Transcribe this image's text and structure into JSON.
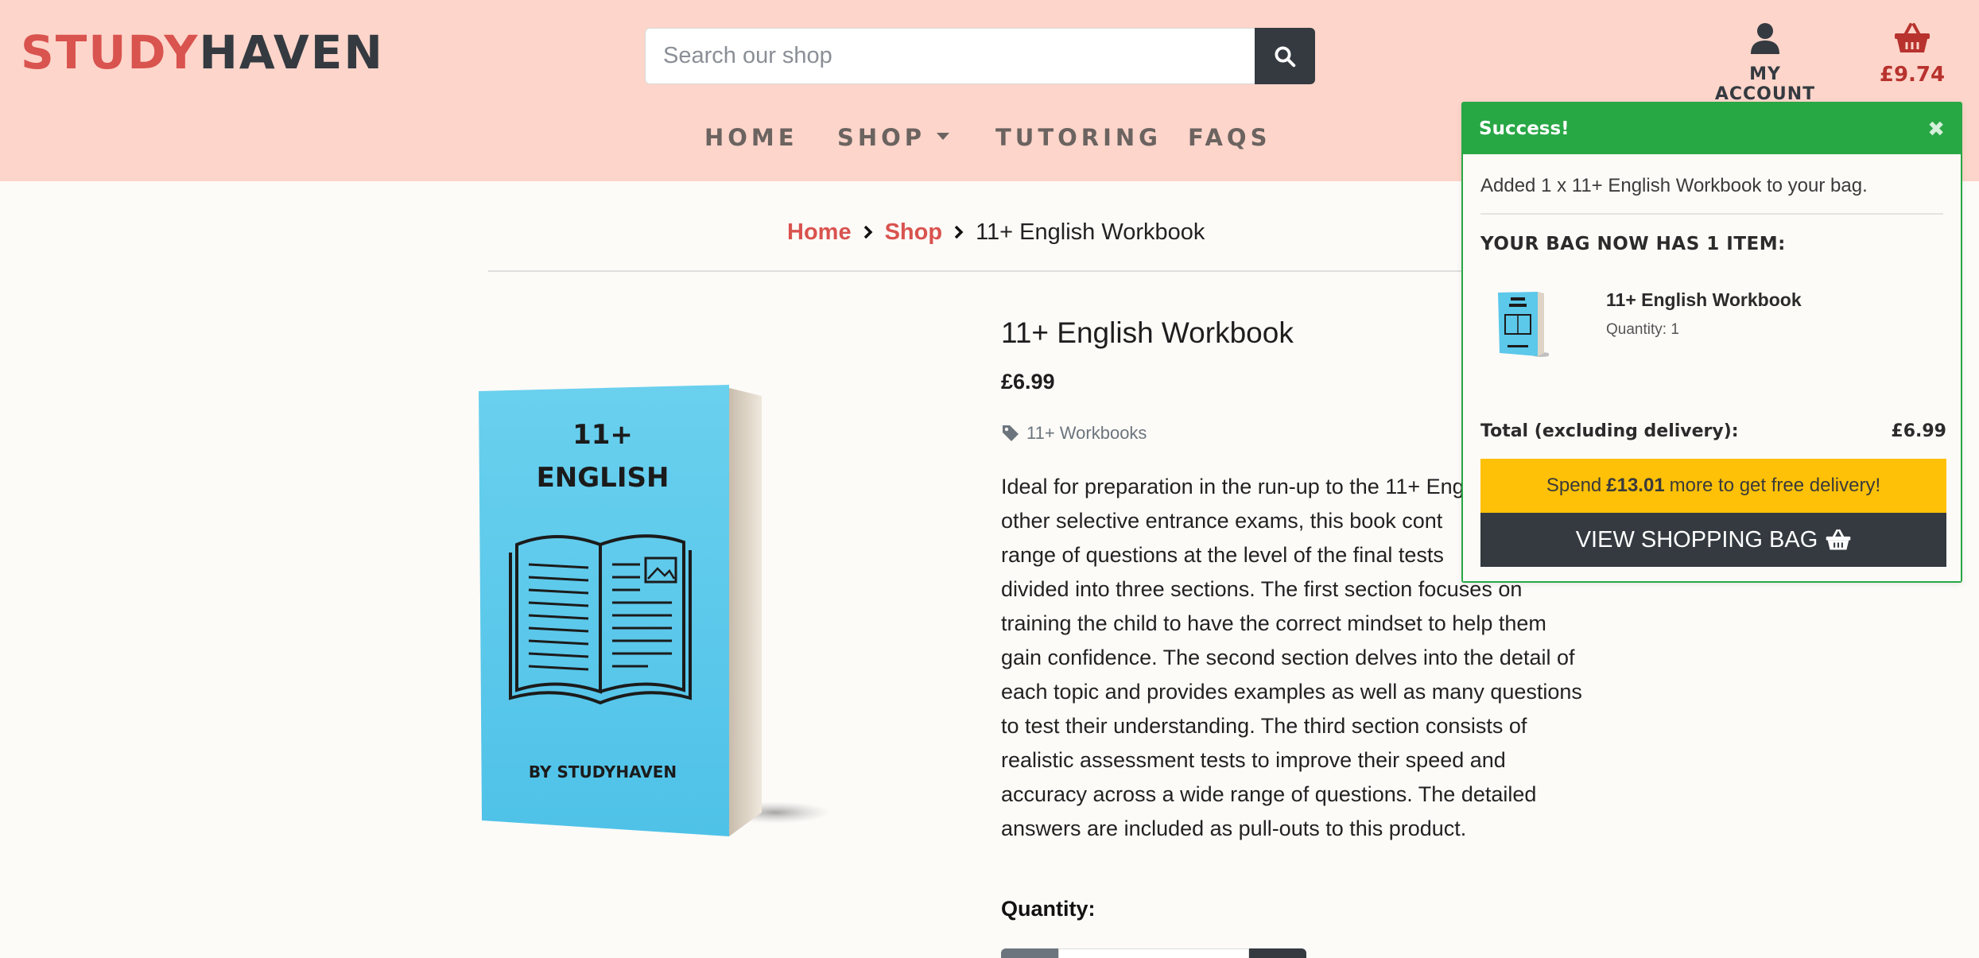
{
  "header": {
    "logo_part1": "STUDY",
    "logo_part2": "HAVEN",
    "search_placeholder": "Search our shop",
    "search_icon": "search-icon",
    "account_label": "MY ACCOUNT",
    "account_icon": "user-icon",
    "bag_icon": "basket-icon",
    "bag_total": "£9.74"
  },
  "nav": {
    "items": [
      {
        "label": "HOME"
      },
      {
        "label": "SHOP"
      },
      {
        "label": "TUTORING"
      },
      {
        "label": "FAQS"
      }
    ]
  },
  "breadcrumb": {
    "home": "Home",
    "shop": "Shop",
    "current": "11+ English Workbook"
  },
  "product": {
    "title": "11+ English Workbook",
    "price": "£6.99",
    "category": "11+ Workbooks",
    "cover_line1": "11+",
    "cover_line2": "ENGLISH",
    "cover_author": "BY STUDYHAVEN",
    "description_lines": [
      "Ideal for preparation in the run-up to the 11+ Eng",
      "other selective entrance exams, this book cont",
      "range of questions at the level of the final tests",
      "divided into three sections. The first section focuses on",
      "training the child to have the correct mindset to help them",
      "gain confidence. The second section delves into the detail of",
      "each topic and provides examples as well as many questions",
      "to test their understanding. The third section consists of",
      "realistic assessment tests to improve their speed and",
      "accuracy across a wide range of questions. The detailed",
      "answers are included as pull-outs to this product."
    ],
    "quantity_label": "Quantity:"
  },
  "toast": {
    "title": "Success!",
    "close_icon": "close-icon",
    "message": "Added 1 x 11+ English Workbook to your bag.",
    "count": "YOUR BAG NOW HAS 1 ITEM:",
    "item_name": "11+ English Workbook",
    "item_qty": "Quantity: 1",
    "total_label": "Total (excluding delivery):",
    "total_value": "£6.99",
    "delivery_pre": "Spend",
    "delivery_amount": "£13.01",
    "delivery_post": "more to get free delivery!",
    "button_label": "VIEW SHOPPING BAG",
    "success_color": "#28a745",
    "warning_color": "#ffc107"
  },
  "colors": {
    "header_bg": "#fdd5ca",
    "brand_red": "#d9534f",
    "dark": "#343a40"
  }
}
